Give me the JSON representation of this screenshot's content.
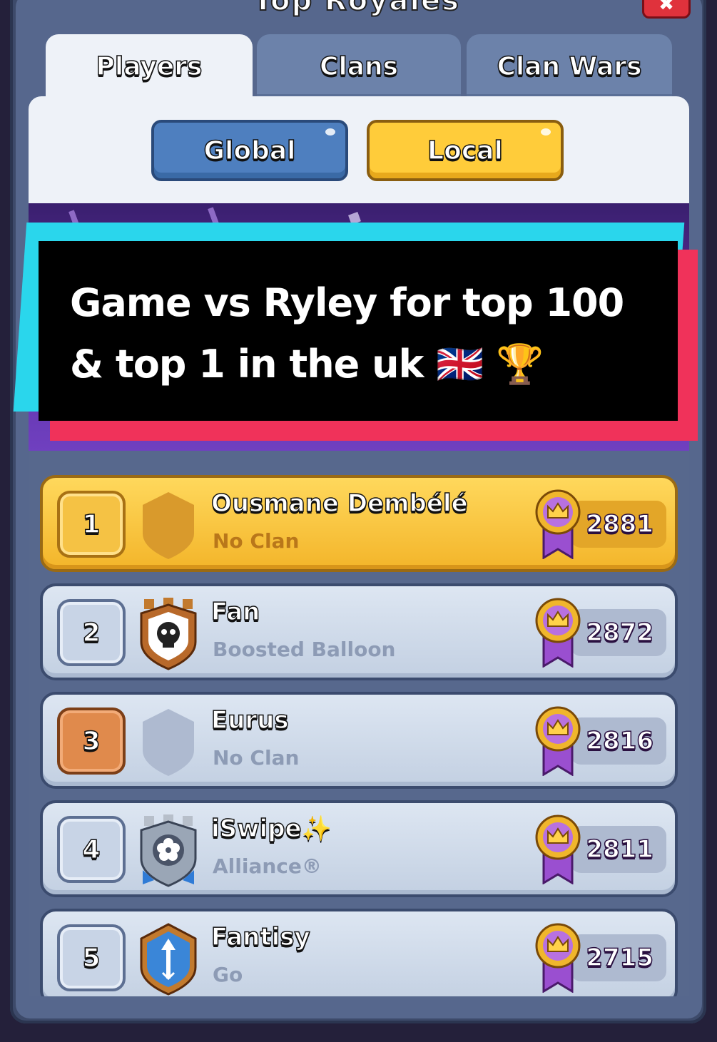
{
  "header": {
    "title": "Top Royales"
  },
  "tabs": [
    {
      "label": "Players",
      "active": true
    },
    {
      "label": "Clans",
      "active": false
    },
    {
      "label": "Clan Wars",
      "active": false
    }
  ],
  "filter": {
    "global_label": "Global",
    "local_label": "Local",
    "selected": "Local"
  },
  "caption": {
    "line1": "Game vs Ryley for top 100",
    "line2": "& top 1 in the uk 🇬🇧 🏆"
  },
  "leaderboard": [
    {
      "rank": "1",
      "name": "Ousmane Dembélé",
      "clan": "No Clan",
      "trophies": "2881",
      "style": "gold",
      "rank_style": "gold",
      "badge": "empty-clan-shield-gold-icon"
    },
    {
      "rank": "2",
      "name": "Fan",
      "clan": "Boosted Balloon",
      "trophies": "2872",
      "style": "silver",
      "rank_style": "silver",
      "badge": "skull-clan-badge-icon"
    },
    {
      "rank": "3",
      "name": "Eurus",
      "clan": "No Clan",
      "trophies": "2816",
      "style": "silver",
      "rank_style": "bronze",
      "badge": "empty-clan-shield-icon"
    },
    {
      "rank": "4",
      "name": "iSwipe✨",
      "clan": "Alliance®",
      "trophies": "2811",
      "style": "silver",
      "rank_style": "silver",
      "badge": "flower-clan-badge-icon"
    },
    {
      "rank": "5",
      "name": "Fantisy",
      "clan": "Go",
      "trophies": "2715",
      "style": "silver",
      "rank_style": "silver",
      "badge": "arrow-clan-badge-icon"
    }
  ],
  "colors": {
    "gold_row": "#f3b52a",
    "silver_row": "#c3d0e2",
    "caption_cyan": "#2ad6ec",
    "caption_pink": "#f0325a"
  }
}
